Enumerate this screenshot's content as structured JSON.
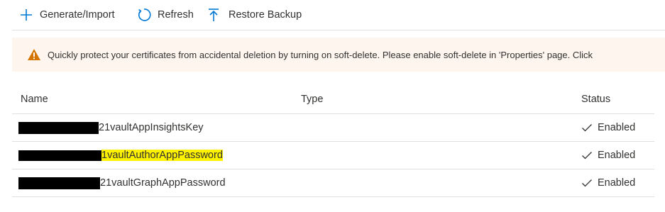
{
  "toolbar": {
    "generate_label": "Generate/Import",
    "refresh_label": "Refresh",
    "restore_label": "Restore Backup",
    "accent_color": "#0078d4"
  },
  "banner": {
    "message": "Quickly protect your certificates from accidental deletion by turning on soft-delete. Please enable soft-delete in 'Properties' page. Click",
    "icon": "warning-icon",
    "icon_color": "#d47500"
  },
  "table": {
    "columns": [
      "Name",
      "Type",
      "Status"
    ],
    "rows": [
      {
        "name": "21vaultAppInsightsKey",
        "type": "",
        "status": "Enabled",
        "highlighted": false
      },
      {
        "name": "1vaultAuthorAppPassword",
        "type": "",
        "status": "Enabled",
        "highlighted": true
      },
      {
        "name": "21vaultGraphAppPassword",
        "type": "",
        "status": "Enabled",
        "highlighted": false
      }
    ]
  }
}
